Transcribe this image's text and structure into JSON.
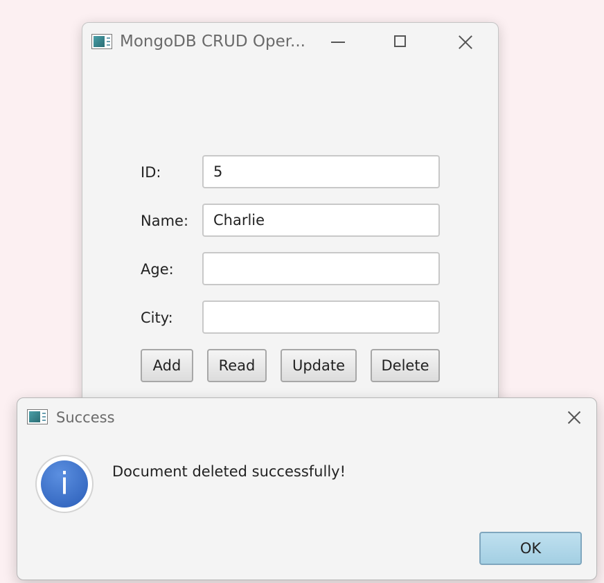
{
  "main_window": {
    "title": "MongoDB CRUD Oper...",
    "icons": [
      "app-icon",
      "minimize-icon",
      "maximize-icon",
      "close-icon"
    ],
    "fields": [
      {
        "label": "ID:",
        "value": "5"
      },
      {
        "label": "Name:",
        "value": "Charlie"
      },
      {
        "label": "Age:",
        "value": ""
      },
      {
        "label": "City:",
        "value": ""
      }
    ],
    "buttons": {
      "add": "Add",
      "read": "Read",
      "update": "Update",
      "delete": "Delete"
    }
  },
  "dialog": {
    "title": "Success",
    "icon": "info-icon",
    "icon_glyph": "i",
    "message": "Document deleted successfully!",
    "ok_label": "OK"
  },
  "colors": {
    "desktop_bg": "#fcf0f2",
    "window_bg": "#f4f4f4",
    "ok_button": "#a3cfe3",
    "info_icon": "#2a5db8"
  }
}
